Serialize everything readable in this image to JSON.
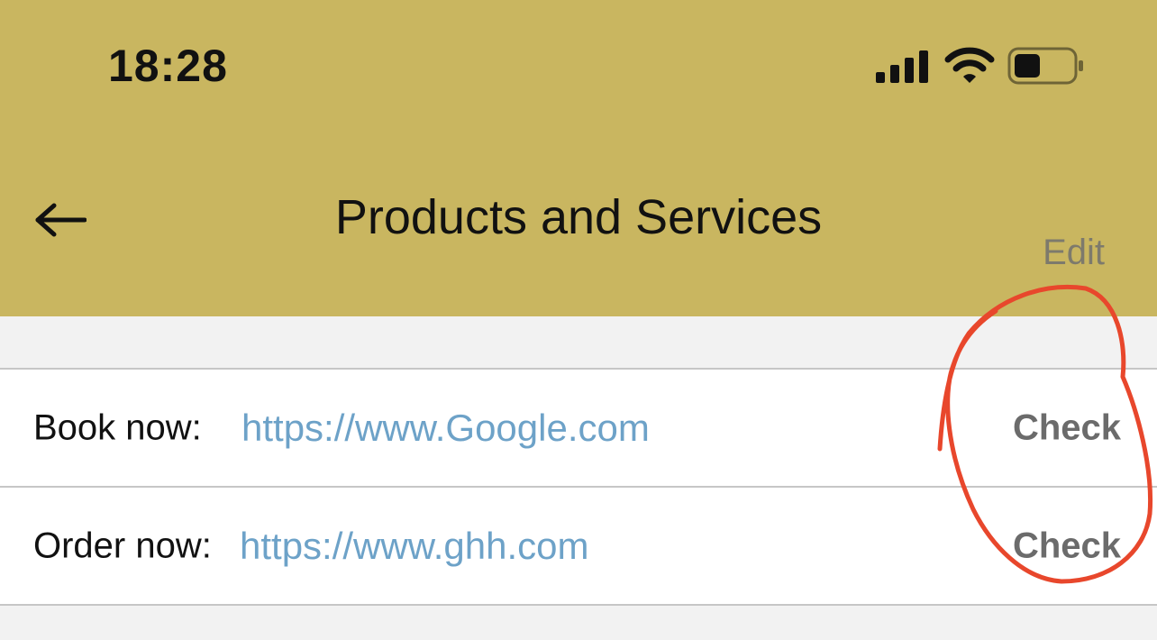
{
  "status_bar": {
    "time": "18:28"
  },
  "header": {
    "back_icon": "arrow-left-icon",
    "title": "Products and Services",
    "edit_label": "Edit",
    "background_color": "#c9b660"
  },
  "rows": [
    {
      "label": "Book now:",
      "link": "https://www.Google.com",
      "action": "Check"
    },
    {
      "label": "Order now:",
      "link": "https://www.ghh.com",
      "action": "Check"
    }
  ],
  "colors": {
    "link": "#6da2c8",
    "annotation": "#e8472c"
  }
}
